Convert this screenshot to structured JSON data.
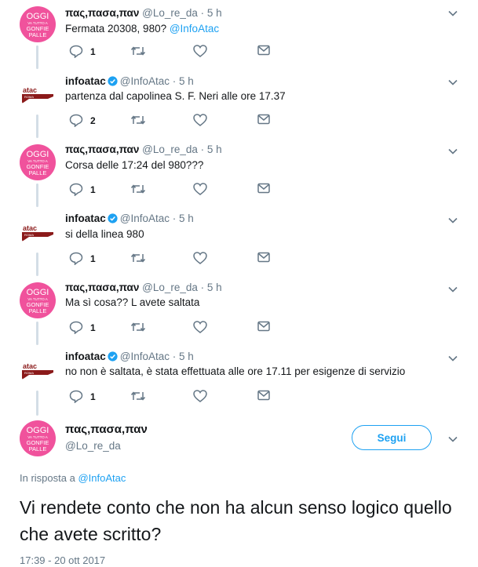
{
  "users": {
    "oggi": {
      "name": "πας,πασα,παν",
      "handle": "@Lo_re_da",
      "avatar_text": [
        "OGGI",
        "VA TUTTO A",
        "GONFIE",
        "PALLE"
      ]
    },
    "atac": {
      "name": "infoatac",
      "handle": "@InfoAtac",
      "avatar_text": [
        "atac",
        "ROMA"
      ]
    }
  },
  "colors": {
    "accent": "#1da1f2",
    "pink_avatar": "#f0529c",
    "atac_maroon": "#8b1a1a",
    "muted": "#657786"
  },
  "thread": [
    {
      "name": "πας,πασα,παν",
      "handle": "@Lo_re_da",
      "time": "5 h",
      "text": "Fermata 20308, 980? ",
      "mention": "@InfoAtac",
      "replies": "1",
      "retweets": "",
      "likes": ""
    },
    {
      "name": "infoatac",
      "handle": "@InfoAtac",
      "time": "5 h",
      "text": "partenza dal capolinea S. F. Neri alle ore 17.37",
      "mention": "",
      "replies": "2",
      "retweets": "",
      "likes": ""
    },
    {
      "name": "πας,πασα,παν",
      "handle": "@Lo_re_da",
      "time": "5 h",
      "text": "Corsa delle 17:24 del 980???",
      "mention": "",
      "replies": "1",
      "retweets": "",
      "likes": ""
    },
    {
      "name": "infoatac",
      "handle": "@InfoAtac",
      "time": "5 h",
      "text": "si della linea 980",
      "mention": "",
      "replies": "1",
      "retweets": "",
      "likes": ""
    },
    {
      "name": "πας,πασα,παν",
      "handle": "@Lo_re_da",
      "time": "5 h",
      "text": "Ma sì cosa?? L avete saltata",
      "mention": "",
      "replies": "1",
      "retweets": "",
      "likes": ""
    },
    {
      "name": "infoatac",
      "handle": "@InfoAtac",
      "time": "5 h",
      "text": "no non è saltata, è stata effettuata alle ore 17.11 per esigenze di servizio",
      "mention": "",
      "replies": "1",
      "retweets": "",
      "likes": ""
    }
  ],
  "main_tweet": {
    "name": "πας,πασα,παν",
    "handle": "@Lo_re_da",
    "follow_label": "Segui",
    "reply_prefix": "In risposta a ",
    "reply_mention": "@InfoAtac",
    "text": "Vi rendete conto che non ha alcun senso logico quello che avete scritto?",
    "timestamp": "17:39 - 20 ott 2017"
  },
  "separator": " · "
}
